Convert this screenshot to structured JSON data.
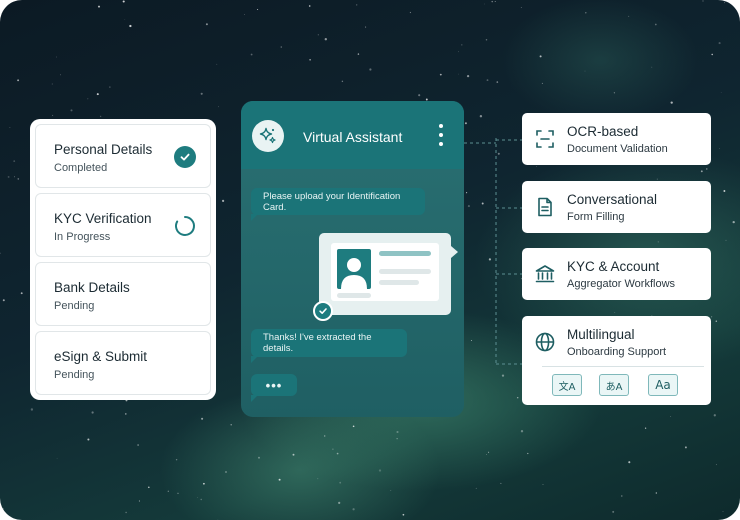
{
  "steps": [
    {
      "title": "Personal Details",
      "status": "Completed",
      "state": "done"
    },
    {
      "title": "KYC Verification",
      "status": "In Progress",
      "state": "progress"
    },
    {
      "title": "Bank Details",
      "status": "Pending",
      "state": "pending"
    },
    {
      "title": "eSign & Submit",
      "status": "Pending",
      "state": "pending"
    }
  ],
  "chat": {
    "title": "Virtual Assistant",
    "messages": [
      "Please upload your Identification Card.",
      "Thanks! I've extracted the details."
    ],
    "typing": "•••"
  },
  "features": [
    {
      "title": "OCR-based",
      "subtitle": "Document Validation",
      "icon": "scan-icon"
    },
    {
      "title": "Conversational",
      "subtitle": "Form Filling",
      "icon": "document-icon"
    },
    {
      "title": "KYC & Account",
      "subtitle": "Aggregator Workflows",
      "icon": "bank-icon"
    },
    {
      "title": "Multilingual",
      "subtitle": "Onboarding Support",
      "icon": "globe-icon"
    }
  ],
  "languages": [
    {
      "glyph": "文A",
      "icon": "translate-icon"
    },
    {
      "glyph": "あA",
      "icon": "hiragana-translate-icon"
    },
    {
      "glyph": "Aa",
      "icon": "font-case-icon"
    }
  ],
  "colors": {
    "accent": "#1e7c7f",
    "header": "#1b7478",
    "panel": "#ffffff"
  }
}
